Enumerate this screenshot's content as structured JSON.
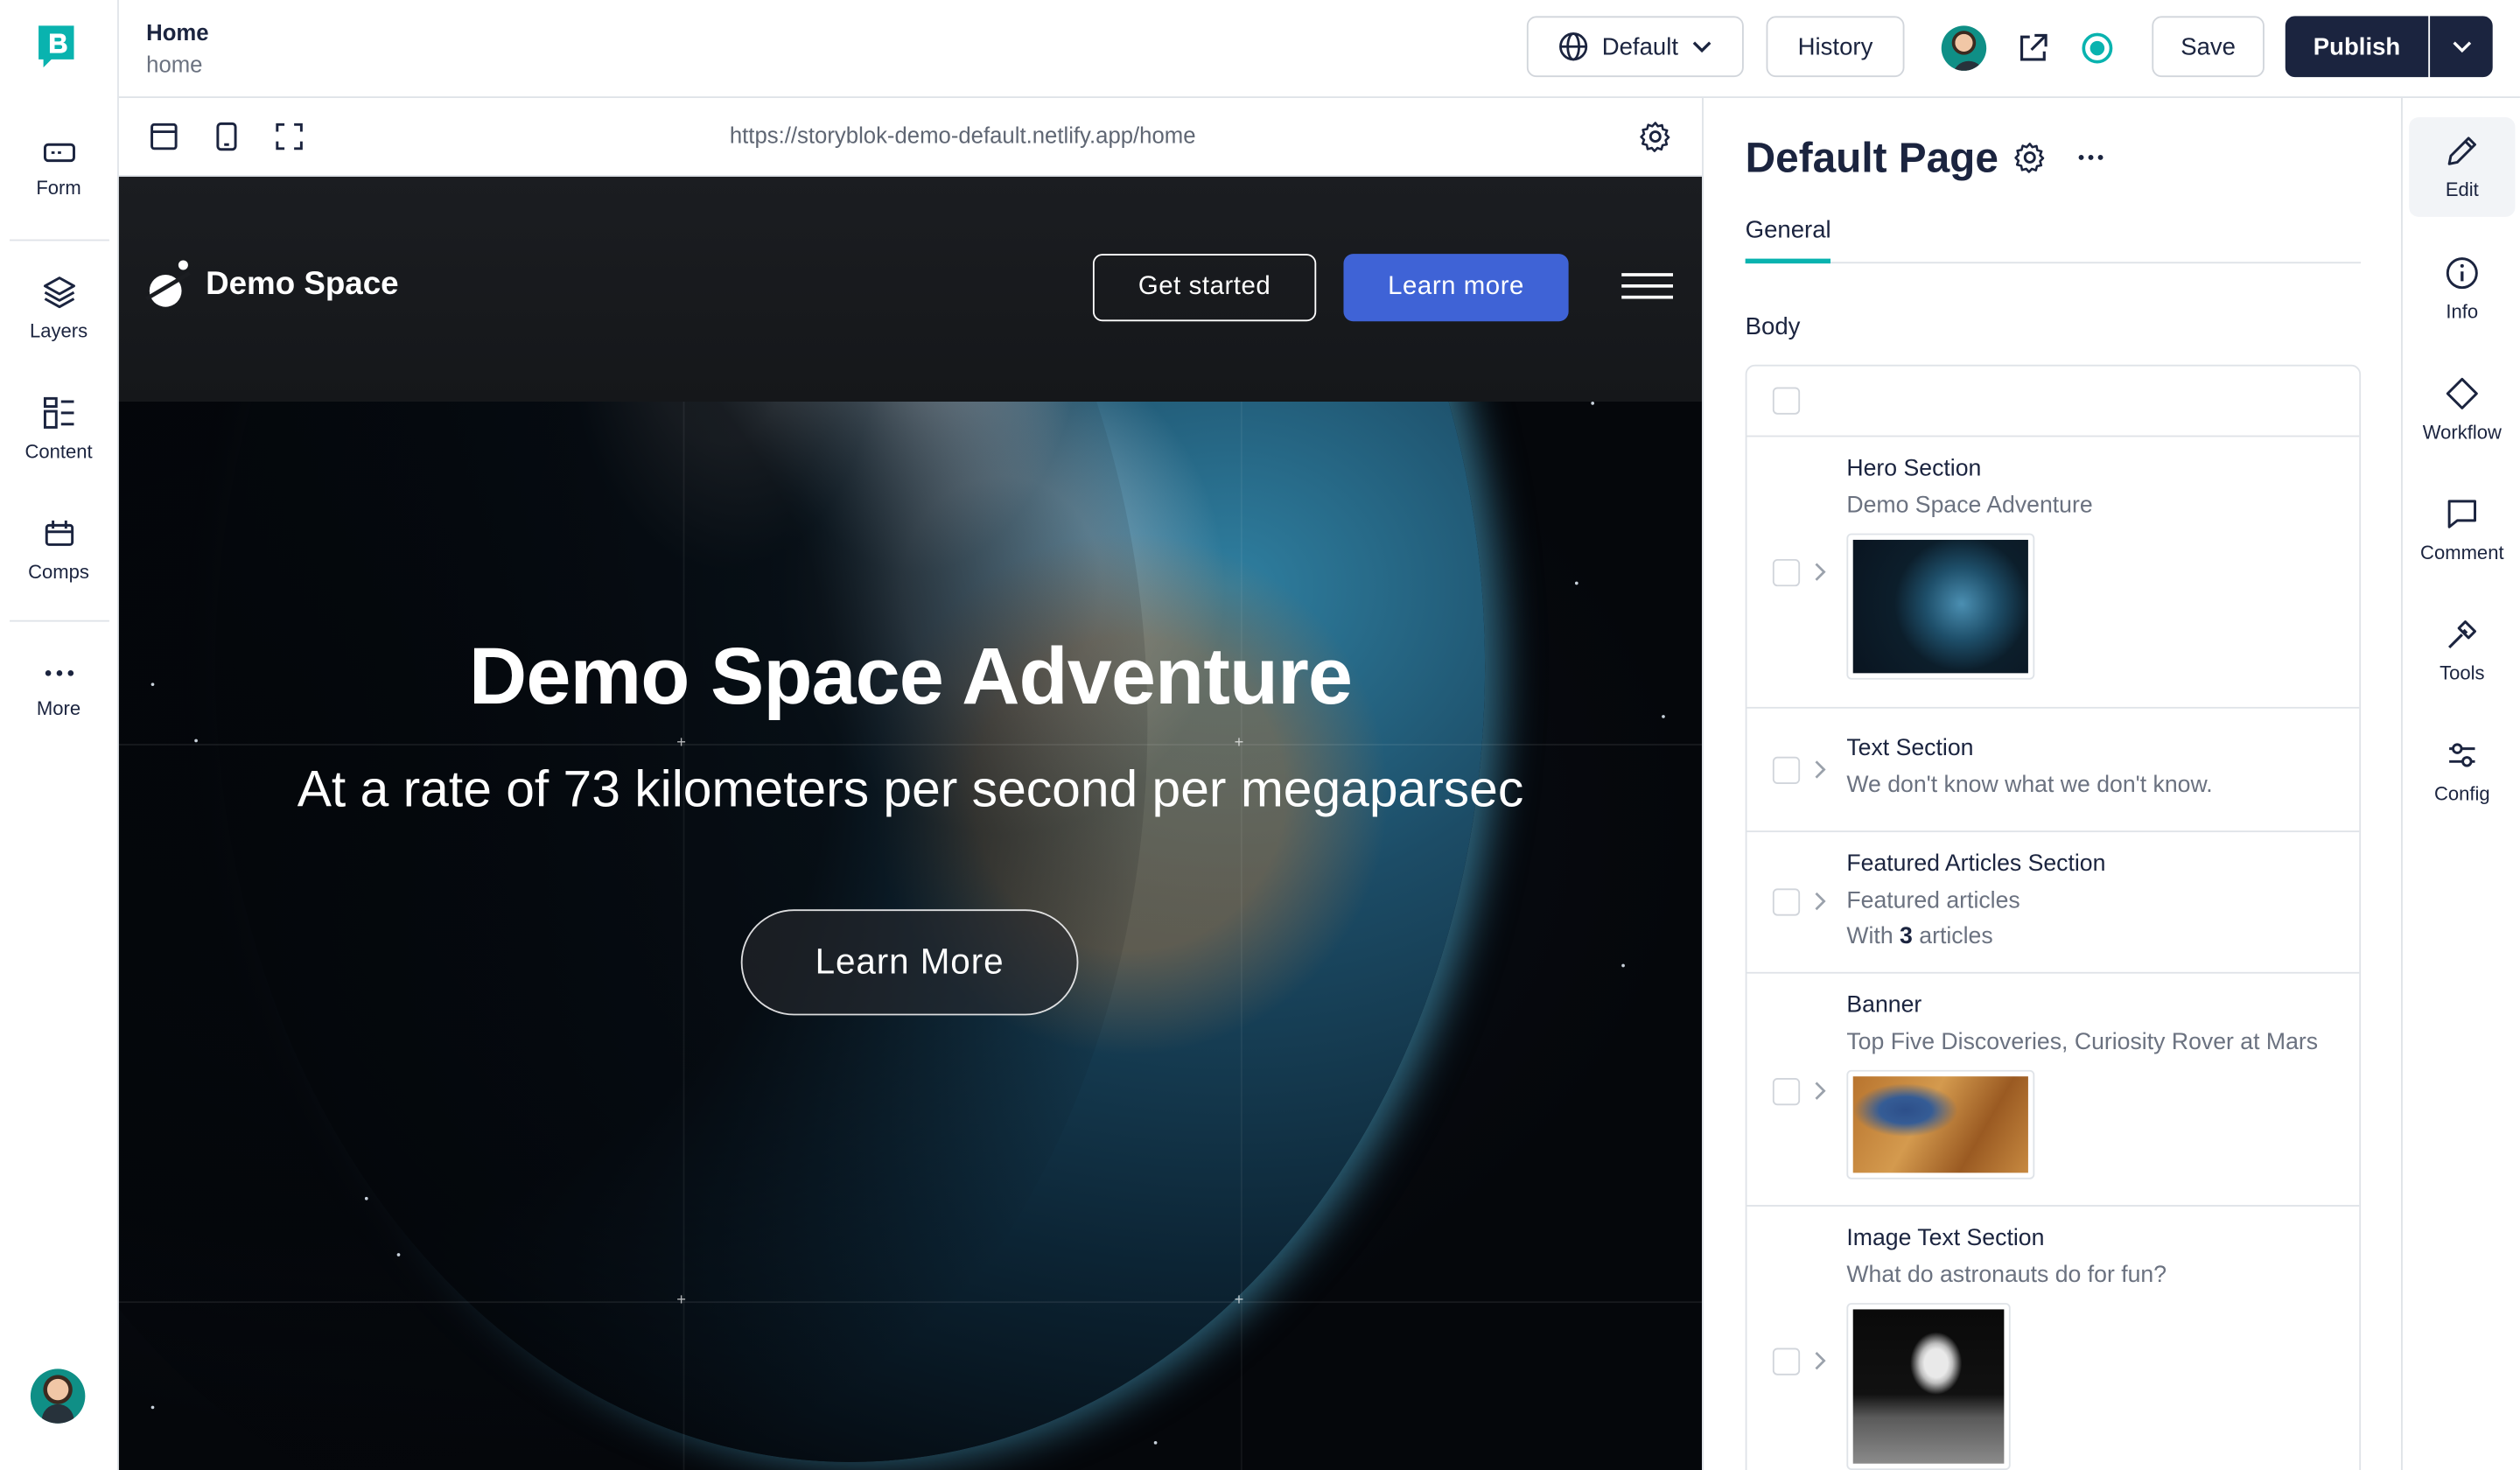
{
  "story": {
    "title": "Home",
    "slug": "home"
  },
  "leftnav": {
    "items": [
      {
        "label": "Form",
        "icon": "form-icon"
      },
      {
        "label": "Layers",
        "icon": "layers-icon"
      },
      {
        "label": "Content",
        "icon": "content-icon"
      },
      {
        "label": "Comps",
        "icon": "comps-icon"
      },
      {
        "label": "More",
        "icon": "more-icon"
      }
    ]
  },
  "topbar": {
    "language": "Default",
    "history": "History",
    "save": "Save",
    "publish": "Publish"
  },
  "previewbar": {
    "url": "https://storyblok-demo-default.netlify.app/home"
  },
  "site": {
    "brand": "Demo Space",
    "nav_primary": "Get started",
    "nav_secondary": "Learn more",
    "hero_title": "Demo Space Adventure",
    "hero_subtitle": "At a rate of 73 kilometers per second per megaparsec",
    "hero_button": "Learn More"
  },
  "panel": {
    "title": "Default Page",
    "tab": "General",
    "body_label": "Body",
    "blocks": [
      {
        "name": "Hero Section",
        "sub": "Demo Space Adventure",
        "thumb": "earth"
      },
      {
        "name": "Text Section",
        "sub": "We don't know what we don't know."
      },
      {
        "name": "Featured Articles Section",
        "sub": "Featured articles",
        "extra_prefix": "With ",
        "extra_count": "3",
        "extra_suffix": " articles"
      },
      {
        "name": "Banner",
        "sub": "Top Five Discoveries, Curiosity Rover at Mars",
        "thumb": "mars"
      },
      {
        "name": "Image Text Section",
        "sub": "What do astronauts do for fun?",
        "thumb": "astronaut"
      }
    ]
  },
  "rail": {
    "items": [
      {
        "label": "Edit",
        "icon": "pencil-icon"
      },
      {
        "label": "Info",
        "icon": "info-icon"
      },
      {
        "label": "Workflow",
        "icon": "workflow-icon"
      },
      {
        "label": "Comment",
        "icon": "comment-icon"
      },
      {
        "label": "Tools",
        "icon": "tools-icon"
      },
      {
        "label": "Config",
        "icon": "config-icon"
      }
    ]
  },
  "colors": {
    "accent": "#09b3af",
    "dark": "#1b243f",
    "blue_button": "#3f63d6"
  }
}
